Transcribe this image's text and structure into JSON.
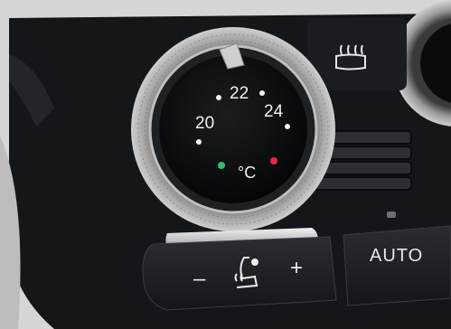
{
  "scene": "car climate control panel close-up",
  "temperature_dial": {
    "scale": [
      "20",
      "22",
      "24"
    ],
    "unit": "°C",
    "cold_indicator_color": "#2fbf71",
    "warm_indicator_color": "#e0294d"
  },
  "controls": {
    "rear_defrost_icon": "rear-window-defrost-icon",
    "seat_heat_icon": "heated-seat-icon",
    "minus": "–",
    "plus": "+",
    "auto": "AUTO"
  },
  "colors": {
    "panel_black": "#101214",
    "trim_silver": "#c9c9c9",
    "label_white": "#f0f0f0"
  }
}
